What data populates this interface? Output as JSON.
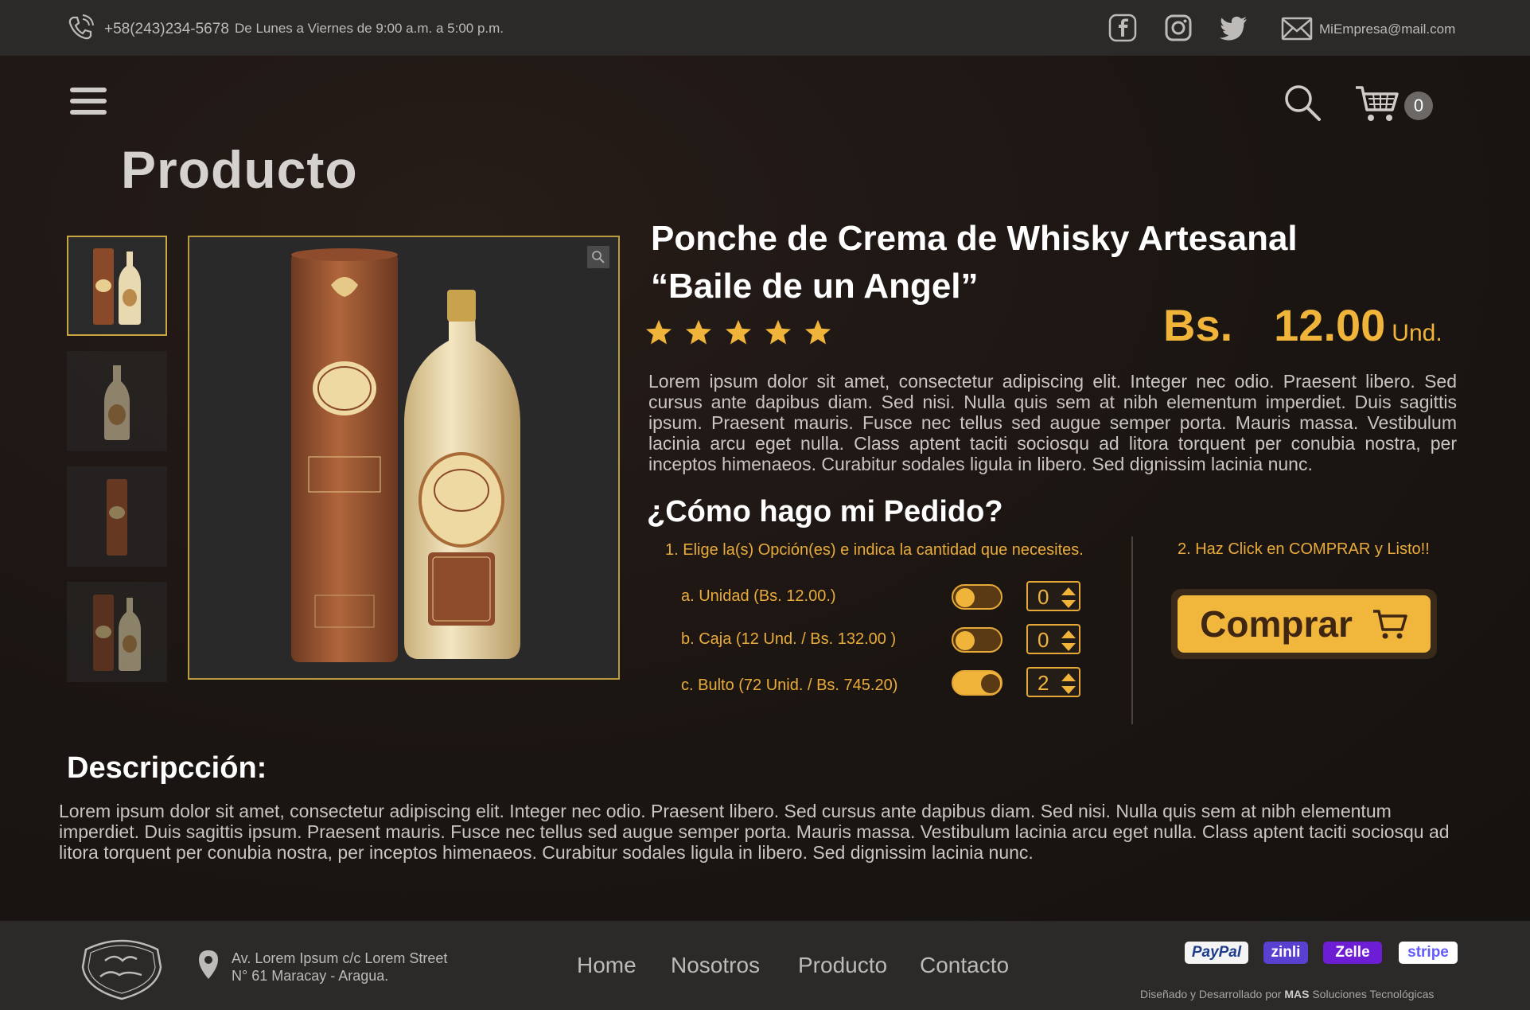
{
  "topbar": {
    "phone": "+58(243)234-5678",
    "hours": "De Lunes a Viernes de 9:00 a.m. a 5:00 p.m.",
    "social_icons": [
      "facebook-icon",
      "instagram-icon",
      "twitter-icon"
    ],
    "email": "MiEmpresa@mail.com"
  },
  "header": {
    "cart_count": "0",
    "page_title": "Producto"
  },
  "product": {
    "name_line1": "Ponche de Crema de Whisky Artesanal",
    "name_line2": "“Baile de un Angel”",
    "rating": 5,
    "price_currency": "Bs.",
    "price_value": "12.00",
    "price_unit": "Und.",
    "description_short": "Lorem ipsum dolor sit amet, consectetur adipiscing elit. Integer nec odio. Praesent libero. Sed cursus ante dapibus diam. Sed nisi. Nulla quis sem at nibh elementum imperdiet. Duis sagittis ipsum. Praesent mauris. Fusce nec tellus sed augue semper porta. Mauris massa. Vestibulum lacinia arcu eget nulla. Class aptent taciti sociosqu ad litora torquent per conubia nostra, per inceptos himenaeos. Curabitur sodales ligula in libero. Sed dignissim lacinia nunc."
  },
  "order": {
    "title": "¿Cómo hago mi Pedido?",
    "step1": "1. Elige la(s) Opción(es) e indica la cantidad que necesites.",
    "step2": "2. Haz Click en COMPRAR y Listo!!",
    "options": [
      {
        "label": "a. Unidad (Bs. 12.00.)",
        "enabled": false,
        "qty": "0"
      },
      {
        "label": "b. Caja  (12 Und. / Bs.  132.00 )",
        "enabled": false,
        "qty": "0"
      },
      {
        "label": "c. Bulto (72 Unid. / Bs. 745.20)",
        "enabled": true,
        "qty": "2"
      }
    ],
    "buy_label": "Comprar"
  },
  "description": {
    "title": "Descripcción:",
    "text": "Lorem ipsum dolor sit amet, consectetur adipiscing elit. Integer nec odio. Praesent libero. Sed cursus ante dapibus diam. Sed nisi. Nulla quis sem at nibh elementum imperdiet. Duis sagittis ipsum. Praesent mauris. Fusce nec tellus sed augue semper porta. Mauris massa. Vestibulum lacinia arcu eget nulla. Class aptent taciti sociosqu ad litora torquent per conubia nostra, per inceptos himenaeos. Curabitur sodales ligula in libero. Sed dignissim lacinia nunc."
  },
  "footer": {
    "address_line1": "Av. Lorem Ipsum c/c  Lorem Street",
    "address_line2": "N° 61 Maracay - Aragua.",
    "nav": [
      "Home",
      "Nosotros",
      "Producto",
      "Contacto"
    ],
    "payments": [
      "PayPal",
      "zinli",
      "Zelle",
      "stripe"
    ],
    "credit_prefix": "Diseñado y Desarrollado por",
    "credit_brand": "MAS",
    "credit_suffix": "Soluciones Tecnológicas"
  },
  "colors": {
    "accent": "#f0b43a",
    "background": "#1a1513",
    "bar": "#2b2a29"
  }
}
